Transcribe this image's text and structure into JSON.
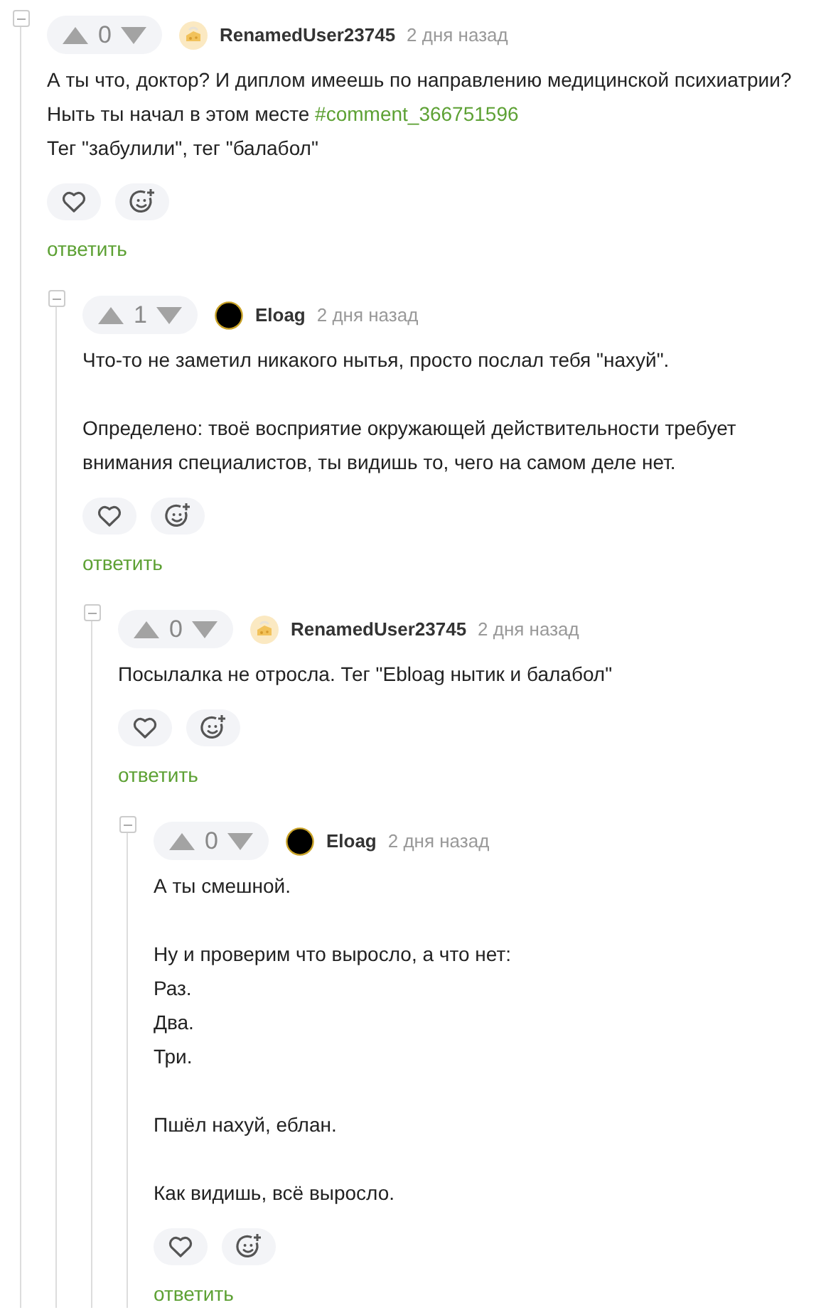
{
  "thread": [
    {
      "author": "RenamedUser23745",
      "avatar": {
        "kind": "sticker"
      },
      "time": "2 дня назад",
      "votes": "0",
      "paragraphs": [
        [
          "А ты что, доктор? И диплом имеешь по направлению медицинской психиатрии?",
          {
            "text": "Ныть ты начал в этом месте ",
            "link": "#comment_366751596"
          },
          "Тег \"забулили\", тег \"балабол\""
        ]
      ],
      "reply": "ответить",
      "children": [
        {
          "author": "Eloag",
          "avatar": {
            "kind": "solid"
          },
          "time": "2 дня назад",
          "votes": "1",
          "paragraphs": [
            [
              "Что-то не заметил никакого нытья, просто послал тебя \"нахуй\"."
            ],
            [
              "Определено: твоё восприятие окружающей действительности требует",
              "внимания специалистов, ты видишь то, чего на самом деле нет."
            ]
          ],
          "reply": "ответить",
          "children": [
            {
              "author": "RenamedUser23745",
              "avatar": {
                "kind": "sticker"
              },
              "time": "2 дня назад",
              "votes": "0",
              "paragraphs": [
                [
                  "Посылалка не отросла. Тег \"Ebloag нытик и балабол\""
                ]
              ],
              "reply": "ответить",
              "children": [
                {
                  "author": "Eloag",
                  "avatar": {
                    "kind": "solid"
                  },
                  "time": "2 дня назад",
                  "votes": "0",
                  "paragraphs": [
                    [
                      "А ты смешной."
                    ],
                    [
                      "Ну и проверим что выросло, а что нет:",
                      "Раз.",
                      "Два.",
                      "Три."
                    ],
                    [
                      "Пшёл нахуй, еблан."
                    ],
                    [
                      "Как видишь, всё выросло."
                    ]
                  ],
                  "reply": "ответить"
                }
              ]
            }
          ]
        }
      ]
    }
  ]
}
